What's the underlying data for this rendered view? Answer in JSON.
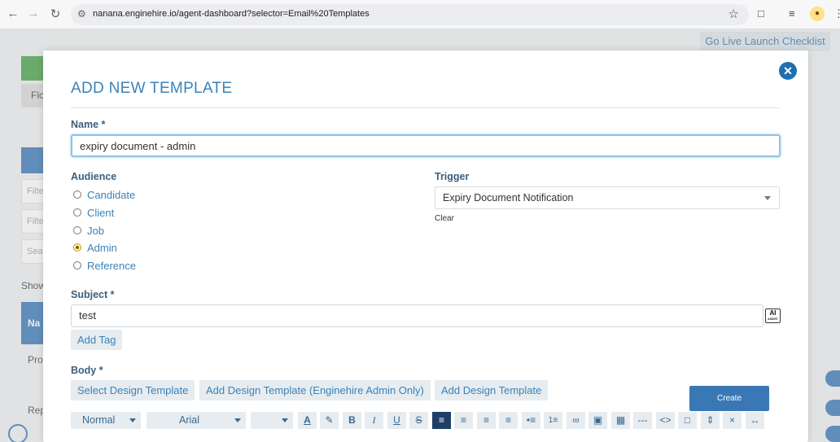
{
  "browser": {
    "url": "nanana.enginehire.io/agent-dashboard?selector=Email%20Templates"
  },
  "background": {
    "go_live": "Go Live Launch Checklist",
    "grey_tab_text": "Flo",
    "filter1": "Filte",
    "filter2": "Filte",
    "search": "Sea",
    "show_text": "Show",
    "nav_text": "Na",
    "pro_text": "Pro",
    "rep_text": "Rep"
  },
  "modal": {
    "title": "ADD NEW TEMPLATE",
    "name_label": "Name *",
    "name_value": "expiry document - admin",
    "audience_label": "Audience",
    "audience_options": [
      "Candidate",
      "Client",
      "Job",
      "Admin",
      "Reference"
    ],
    "audience_selected": "Admin",
    "trigger_label": "Trigger",
    "trigger_value": "Expiry Document Notification",
    "clear_label": "Clear",
    "subject_label": "Subject *",
    "subject_value": "test",
    "ai_badge": "AI",
    "ai_badge_sub": "ASSIST",
    "add_tag_label": "Add Tag",
    "body_label": "Body *",
    "design_buttons": [
      "Select Design Template",
      "Add Design Template (Enginehire Admin Only)",
      "Add Design Template"
    ],
    "create_label": "Create",
    "toolbar": {
      "style_select": "Normal",
      "font_select": "Arial",
      "size_select": "",
      "icons": [
        "font-color-icon",
        "highlight-icon",
        "bold-icon",
        "italic-icon",
        "underline-icon",
        "strikethrough-icon",
        "align-left-icon",
        "align-center-icon",
        "align-right-icon",
        "align-justify-icon",
        "bullet-list-icon",
        "numbered-list-icon",
        "link-icon",
        "image-icon",
        "table-icon",
        "horizontal-rule-icon",
        "code-view-icon",
        "select-all-icon",
        "expand-icon",
        "collapse-icon",
        "fullwidth-icon"
      ]
    }
  },
  "colors": {
    "accent": "#3b82b8",
    "primary_button": "#3a78b5",
    "close_button": "#1f6fb2"
  }
}
